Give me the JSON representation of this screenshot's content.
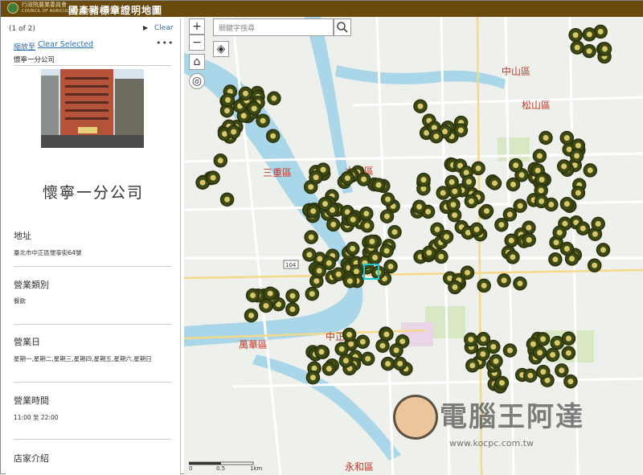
{
  "header": {
    "org_line1": "行政院農業委員會",
    "org_line2": "COUNCIL OF AGRICULTURE, EXECUTIVE YUAN",
    "title": "國產豬標章證明地圖"
  },
  "panel": {
    "pager": "(1 of 2)",
    "next_arrow": "▶",
    "clear": "Clear",
    "zoom_to": "縮放至",
    "clear_selected": "Clear Selected",
    "more": "•••",
    "small_title": "懷寧一分公司",
    "shop_name": "懷寧一分公司",
    "fields": [
      {
        "label": "地址",
        "value": "臺北市中正區懷寧街64號"
      },
      {
        "label": "營業類別",
        "value": "餐飲"
      },
      {
        "label": "營業日",
        "value": "星期一,星期二,星期三,星期四,星期五,星期六,星期日"
      },
      {
        "label": "營業時間",
        "value": "11:00 至 22:00"
      },
      {
        "label": "店家介紹",
        "value": ""
      }
    ]
  },
  "map": {
    "search_placeholder": "關鍵字搜尋",
    "zoom_in": "+",
    "zoom_out": "−",
    "home": "⌂",
    "districts": [
      "中山區",
      "松山區",
      "大同區",
      "三重區",
      "中正區",
      "萬華區",
      "永和區"
    ],
    "labels": {
      "road_code": "104",
      "scale_0": "0",
      "scale_mid": "0.5",
      "scale_end": "1km"
    },
    "colors": {
      "marker": "#3d4a14",
      "marker_ring": "#2a2f0c",
      "river": "#a9d6e8",
      "district": "#c0392b"
    }
  },
  "watermark": {
    "text": "電腦王阿達",
    "url": "www.kocpc.com.tw"
  }
}
